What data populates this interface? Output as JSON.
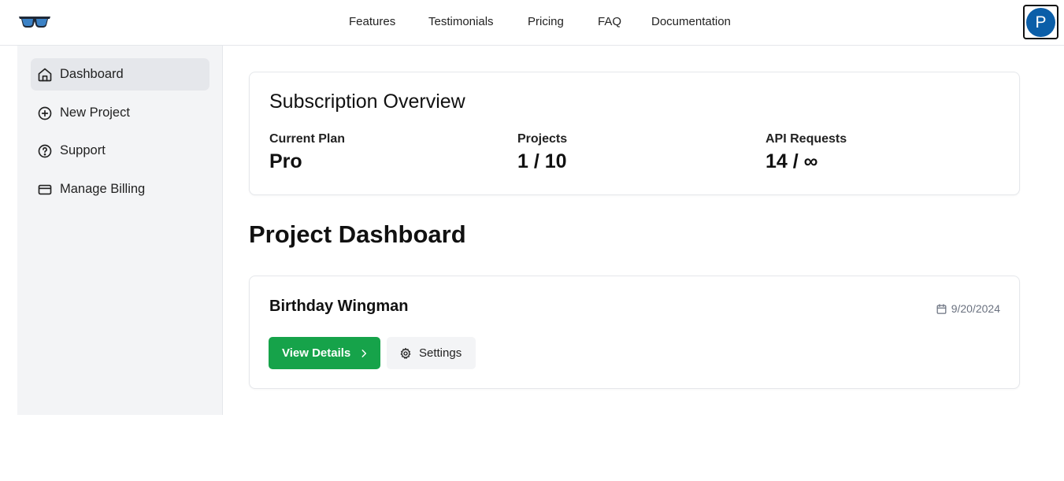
{
  "header": {
    "nav": [
      "Features",
      "Testimonials",
      "Pricing",
      "FAQ",
      "Documentation"
    ],
    "avatar_initial": "P",
    "avatar_color": "#0b5ea8"
  },
  "sidebar": {
    "items": [
      {
        "label": "Dashboard",
        "icon": "home-icon",
        "active": true
      },
      {
        "label": "New Project",
        "icon": "plus-circle-icon"
      },
      {
        "label": "Support",
        "icon": "help-circle-icon"
      },
      {
        "label": "Manage Billing",
        "icon": "credit-card-icon"
      }
    ]
  },
  "subscription": {
    "title": "Subscription Overview",
    "stats": [
      {
        "label": "Current Plan",
        "value": "Pro"
      },
      {
        "label": "Projects",
        "value": "1 / 10"
      },
      {
        "label": "API Requests",
        "value": "14 / ∞"
      }
    ]
  },
  "dashboard": {
    "title": "Project Dashboard",
    "project": {
      "name": "Birthday Wingman",
      "date": "9/20/2024",
      "view_label": "View Details",
      "settings_label": "Settings"
    }
  },
  "colors": {
    "accent_green": "#16a34a",
    "sidebar_bg": "#f3f4f6"
  }
}
